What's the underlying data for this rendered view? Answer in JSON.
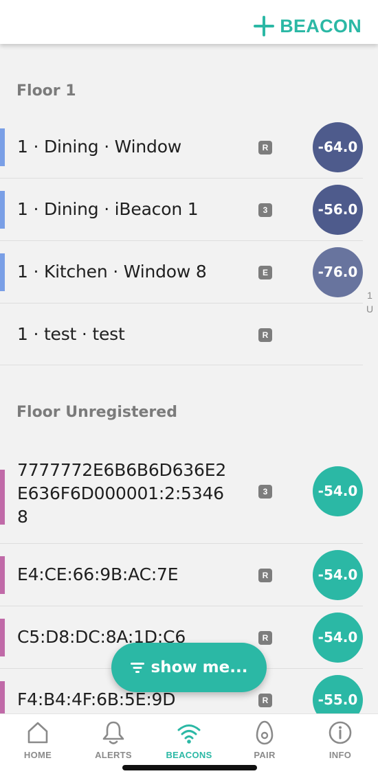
{
  "header": {
    "add_beacon_label": "BEACON"
  },
  "sections": [
    {
      "title": "Floor 1",
      "rows": [
        {
          "name": "1 · Dining · Window",
          "badge": "R",
          "rssi": "-64.0",
          "rssi_color": "#4e5b8c",
          "accent_color": "#7a9fe6"
        },
        {
          "name": "1 · Dining · iBeacon 1",
          "badge": "3",
          "rssi": "-56.0",
          "rssi_color": "#4e5b8c",
          "accent_color": "#7a9fe6"
        },
        {
          "name": "1 · Kitchen · Window 8",
          "badge": "E",
          "rssi": "-76.0",
          "rssi_color": "#68749e",
          "accent_color": "#7a9fe6"
        },
        {
          "name": "1 · test · test",
          "badge": "R",
          "rssi": "",
          "rssi_color": "",
          "accent_color": ""
        }
      ]
    },
    {
      "title": "Floor Unregistered",
      "rows": [
        {
          "name_lines": [
            "7777772E6B6B6D636E2",
            "E636F6D000001:2:5346",
            "8"
          ],
          "badge": "3",
          "rssi": "-54.0",
          "rssi_color": "#2bb8a5",
          "accent_color": "#c06aa8"
        },
        {
          "name": "E4:CE:66:9B:AC:7E",
          "badge": "R",
          "rssi": "-54.0",
          "rssi_color": "#2bb8a5",
          "accent_color": "#c06aa8"
        },
        {
          "name": "C5:D8:DC:8A:1D:C6",
          "badge": "R",
          "rssi": "-54.0",
          "rssi_color": "#2bb8a5",
          "accent_color": "#c06aa8"
        },
        {
          "name": "F4:B4:4F:6B:5E:9D",
          "badge": "R",
          "rssi": "-55.0",
          "rssi_color": "#2bb8a5",
          "accent_color": "#c06aa8"
        }
      ]
    }
  ],
  "index_letters": [
    "1",
    "U"
  ],
  "filter_button": {
    "label": "show me..."
  },
  "tabs": [
    {
      "label": "HOME",
      "icon": "home-icon",
      "active": false
    },
    {
      "label": "ALERTS",
      "icon": "bell-icon",
      "active": false
    },
    {
      "label": "BEACONS",
      "icon": "wifi-signal-icon",
      "active": true
    },
    {
      "label": "PAIR",
      "icon": "pair-icon",
      "active": false
    },
    {
      "label": "INFO",
      "icon": "info-icon",
      "active": false
    }
  ],
  "colors": {
    "accent": "#2bb8a5",
    "inactive": "#8a8a8a"
  }
}
